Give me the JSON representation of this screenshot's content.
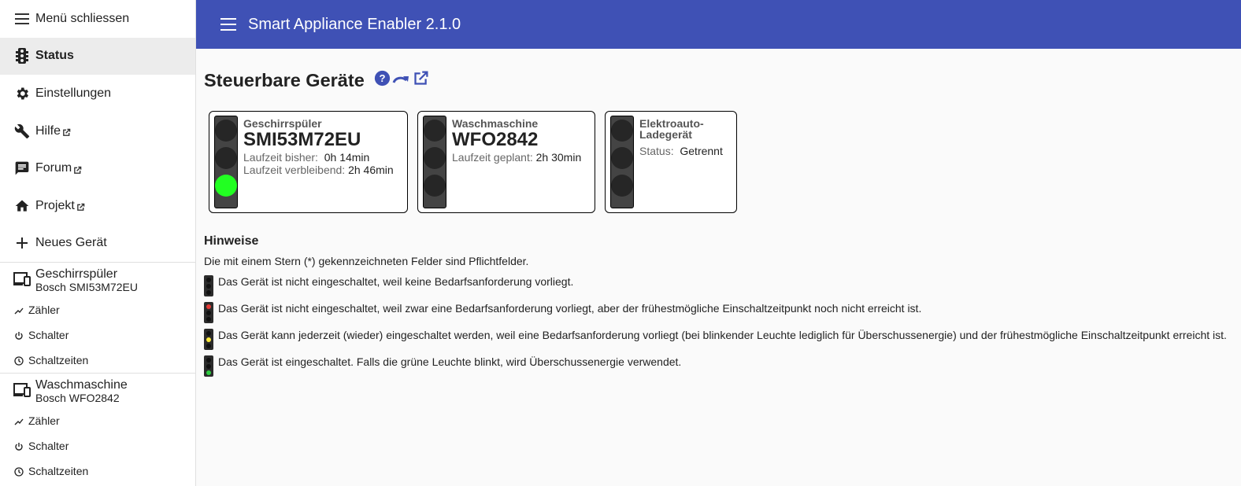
{
  "sidebar": {
    "close_label": "Menü schliessen",
    "items": [
      {
        "label": "Status",
        "icon": "traffic-light-icon"
      },
      {
        "label": "Einstellungen",
        "icon": "gear-icon"
      },
      {
        "label": "Hilfe",
        "icon": "wrench-icon"
      },
      {
        "label": "Forum",
        "icon": "forum-icon"
      },
      {
        "label": "Projekt",
        "icon": "home-icon"
      },
      {
        "label": "Neues Gerät",
        "icon": "plus-icon"
      }
    ],
    "devices": [
      {
        "name": "Geschirrspüler",
        "model": "Bosch SMI53M72EU",
        "sub": [
          "Zähler",
          "Schalter",
          "Schaltzeiten"
        ]
      },
      {
        "name": "Waschmaschine",
        "model": "Bosch WFO2842",
        "sub": [
          "Zähler",
          "Schalter",
          "Schaltzeiten"
        ]
      }
    ]
  },
  "header": {
    "title": "Smart Appliance Enabler 2.1.0"
  },
  "main": {
    "title": "Steuerbare Geräte",
    "cards": [
      {
        "category": "Geschirrspüler",
        "model": "SMI53M72EU",
        "rows": [
          {
            "key": "Laufzeit bisher:",
            "value": "0h 14min"
          },
          {
            "key": "Laufzeit verbleibend:",
            "value": "2h 46min"
          }
        ]
      },
      {
        "category": "Waschmaschine",
        "model": "WFO2842",
        "rows": [
          {
            "key": "Laufzeit geplant:",
            "value": "2h 30min"
          }
        ]
      },
      {
        "category": "Elektroauto-Ladegerät",
        "category_line1": "Elektroauto-",
        "category_line2": "Ladegerät",
        "rows": [
          {
            "key": "Status:",
            "value": "Getrennt"
          }
        ]
      }
    ],
    "hints": {
      "title": "Hinweise",
      "required": "Die mit einem Stern (*) gekennzeichneten Felder sind Pflichtfelder.",
      "legend": [
        "Das Gerät ist nicht eingeschaltet, weil keine Bedarfsanforderung vorliegt.",
        "Das Gerät ist nicht eingeschaltet, weil zwar eine Bedarfsanforderung vorliegt, aber der frühestmögliche Einschaltzeitpunkt noch nicht erreicht ist.",
        "Das Gerät kann jederzeit (wieder) eingeschaltet werden, weil eine Bedarfsanforderung vorliegt (bei blinkender Leuchte lediglich für Überschussenergie) und der frühestmögliche Einschaltzeitpunkt erreicht ist.",
        "Das Gerät ist eingeschaltet. Falls die grüne Leuchte blinkt, wird Überschussenergie verwendet."
      ]
    }
  },
  "colors": {
    "primary": "#3f51b5",
    "lamp_green": "#22ff22",
    "lamp_red": "#e53935",
    "lamp_yellow": "#ffeb3b",
    "lamp_green_small": "#2ecc40"
  }
}
